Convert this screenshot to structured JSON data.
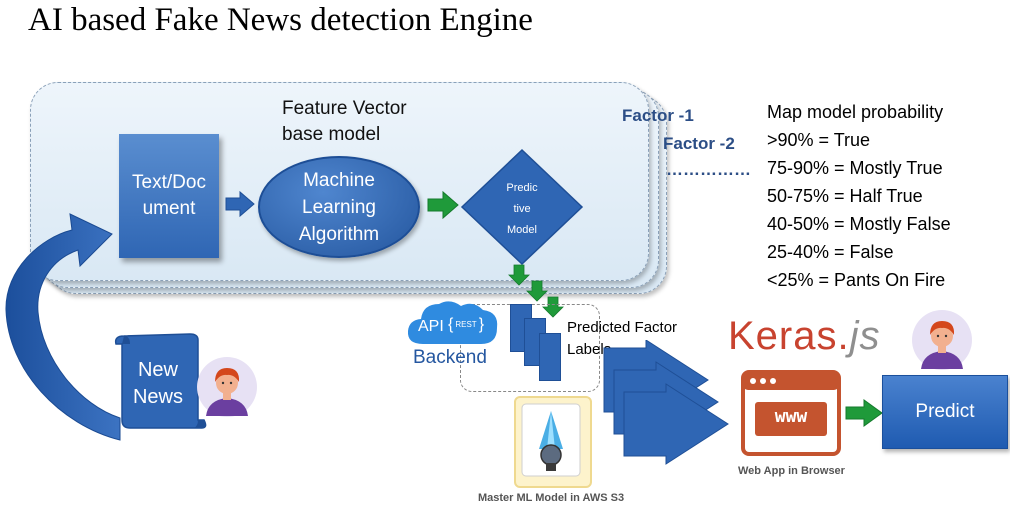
{
  "title": "AI based Fake News detection Engine",
  "feature_vector_label": "Feature Vector base model",
  "text_doc": "Text/Document",
  "ml_algorithm": "Machine Learning Algorithm",
  "predictive_model": "Predictive Model",
  "factor_1": "Factor -1",
  "factor_2": "Factor -2",
  "factor_ellipsis": "……………",
  "map_title": "Map model probability",
  "map_rules": [
    ">90% = True",
    "75-90% = Mostly True",
    "50-75% = Half True",
    "40-50% =  Mostly False",
    "25-40% = False",
    "<25% = Pants On Fire"
  ],
  "new_news": "New News",
  "api_label": "API",
  "rest_label": "REST",
  "backend": "Backend",
  "predicted_factor_labels": "Predicted Factor Labels",
  "master_model": "Master ML Model in AWS S3",
  "keras_main": "Keras.",
  "keras_js": "js",
  "www": "www",
  "web_app": "Web App in Browser",
  "predict": "Predict",
  "colors": {
    "primary_blue": "#2f66b4",
    "dark_blue": "#1f4f96",
    "green_arrow": "#1f9a3a",
    "keras_red": "#c8432f",
    "factor_text": "#2c4e86"
  }
}
